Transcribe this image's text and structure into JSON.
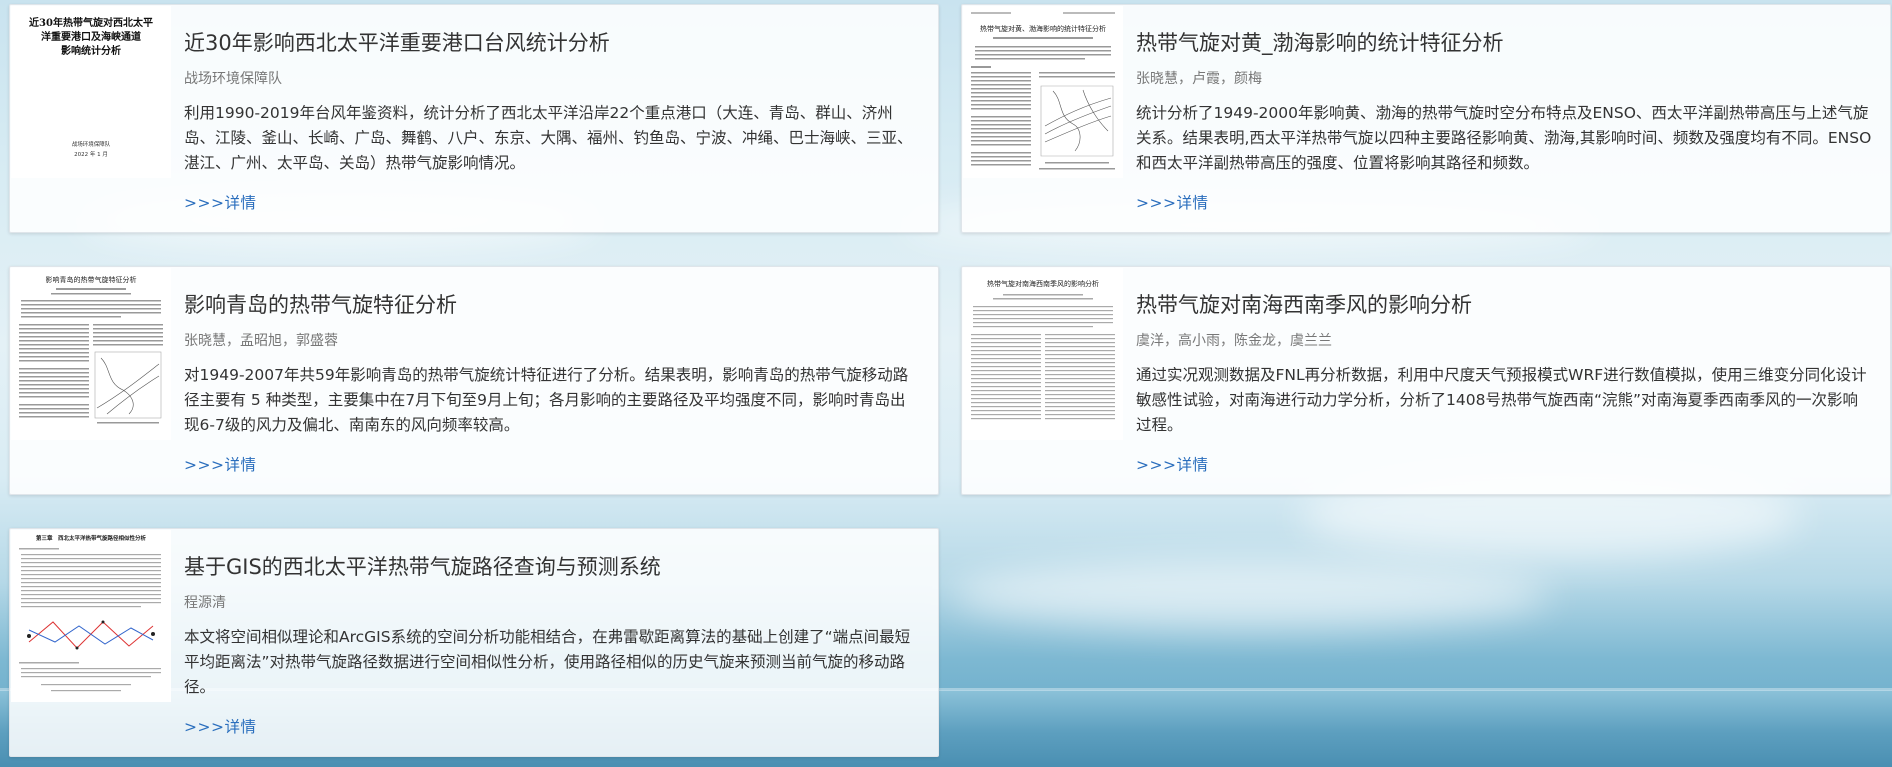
{
  "cards": [
    {
      "title": "近30年影响西北太平洋重要港口台风统计分析",
      "authors": "战场环境保障队",
      "abstract": "利用1990-2019年台风年鉴资料，统计分析了西北太平洋沿岸22个重点港口（大连、青岛、群山、济州岛、江陵、釜山、长崎、广岛、舞鹤、八户、东京、大隅、福州、钓鱼岛、宁波、冲绳、巴士海峡、三亚、湛江、广州、太平岛、关岛）热带气旋影响情况。",
      "detail": ">>>详情",
      "thumb": {
        "title_line1": "近30年热带气旋对西北太平",
        "title_line2": "洋重要港口及海峡通道",
        "title_line3": "影响统计分析",
        "org": "战场环境保障队",
        "date": "2022 年 1 月"
      }
    },
    {
      "title": "热带气旋对黄_渤海影响的统计特征分析",
      "authors": "张晓慧，卢霞，颜梅",
      "abstract": "统计分析了1949-2000年影响黄、渤海的热带气旋时空分布特点及ENSO、西太平洋副热带高压与上述气旋关系。结果表明,西太平洋热带气旋以四种主要路径影响黄、渤海,其影响时间、频数及强度均有不同。ENSO和西太平洋副热带高压的强度、位置将影响其路径和频数。",
      "detail": ">>>详情",
      "thumb": {
        "header": "热带气旋对黄、渤海影响的统计特征分析"
      }
    },
    {
      "title": "影响青岛的热带气旋特征分析",
      "authors": "张晓慧，孟昭旭，郭盛蓉",
      "abstract": "对1949-2007年共59年影响青岛的热带气旋统计特征进行了分析。结果表明，影响青岛的热带气旋移动路径主要有 5 种类型，主要集中在7月下旬至9月上旬；各月影响的主要路径及平均强度不同，影响时青岛出现6-7级的风力及偏北、南南东的风向频率较高。",
      "detail": ">>>详情",
      "thumb": {
        "header": "影响青岛的热带气旋特征分析"
      }
    },
    {
      "title": "热带气旋对南海西南季风的影响分析",
      "authors": "虞洋，高小雨，陈金龙，虞兰兰",
      "abstract": "通过实况观测数据及FNL再分析数据，利用中尺度天气预报模式WRF进行数值模拟，使用三维变分同化设计敏感性试验，对南海进行动力学分析，分析了1408号热带气旋西南“浣熊”对南海夏季西南季风的一次影响过程。",
      "detail": ">>>详情",
      "thumb": {
        "header": "热带气旋对南海西南季风的影响分析"
      }
    },
    {
      "title": "基于GIS的西北太平洋热带气旋路径查询与预测系统",
      "authors": "程源清",
      "abstract": "本文将空间相似理论和ArcGIS系统的空间分析功能相结合，在弗雷歇距离算法的基础上创建了“端点间最短平均距离法”对热带气旋路径数据进行空间相似性分析，使用路径相似的历史气旋来预测当前气旋的移动路径。",
      "detail": ">>>详情",
      "thumb": {
        "header": "第三章　西北太平洋热带气旋路径相似性分析"
      }
    }
  ],
  "colors": {
    "link": "#2a6ebd",
    "title": "#333333",
    "meta": "#777777"
  }
}
